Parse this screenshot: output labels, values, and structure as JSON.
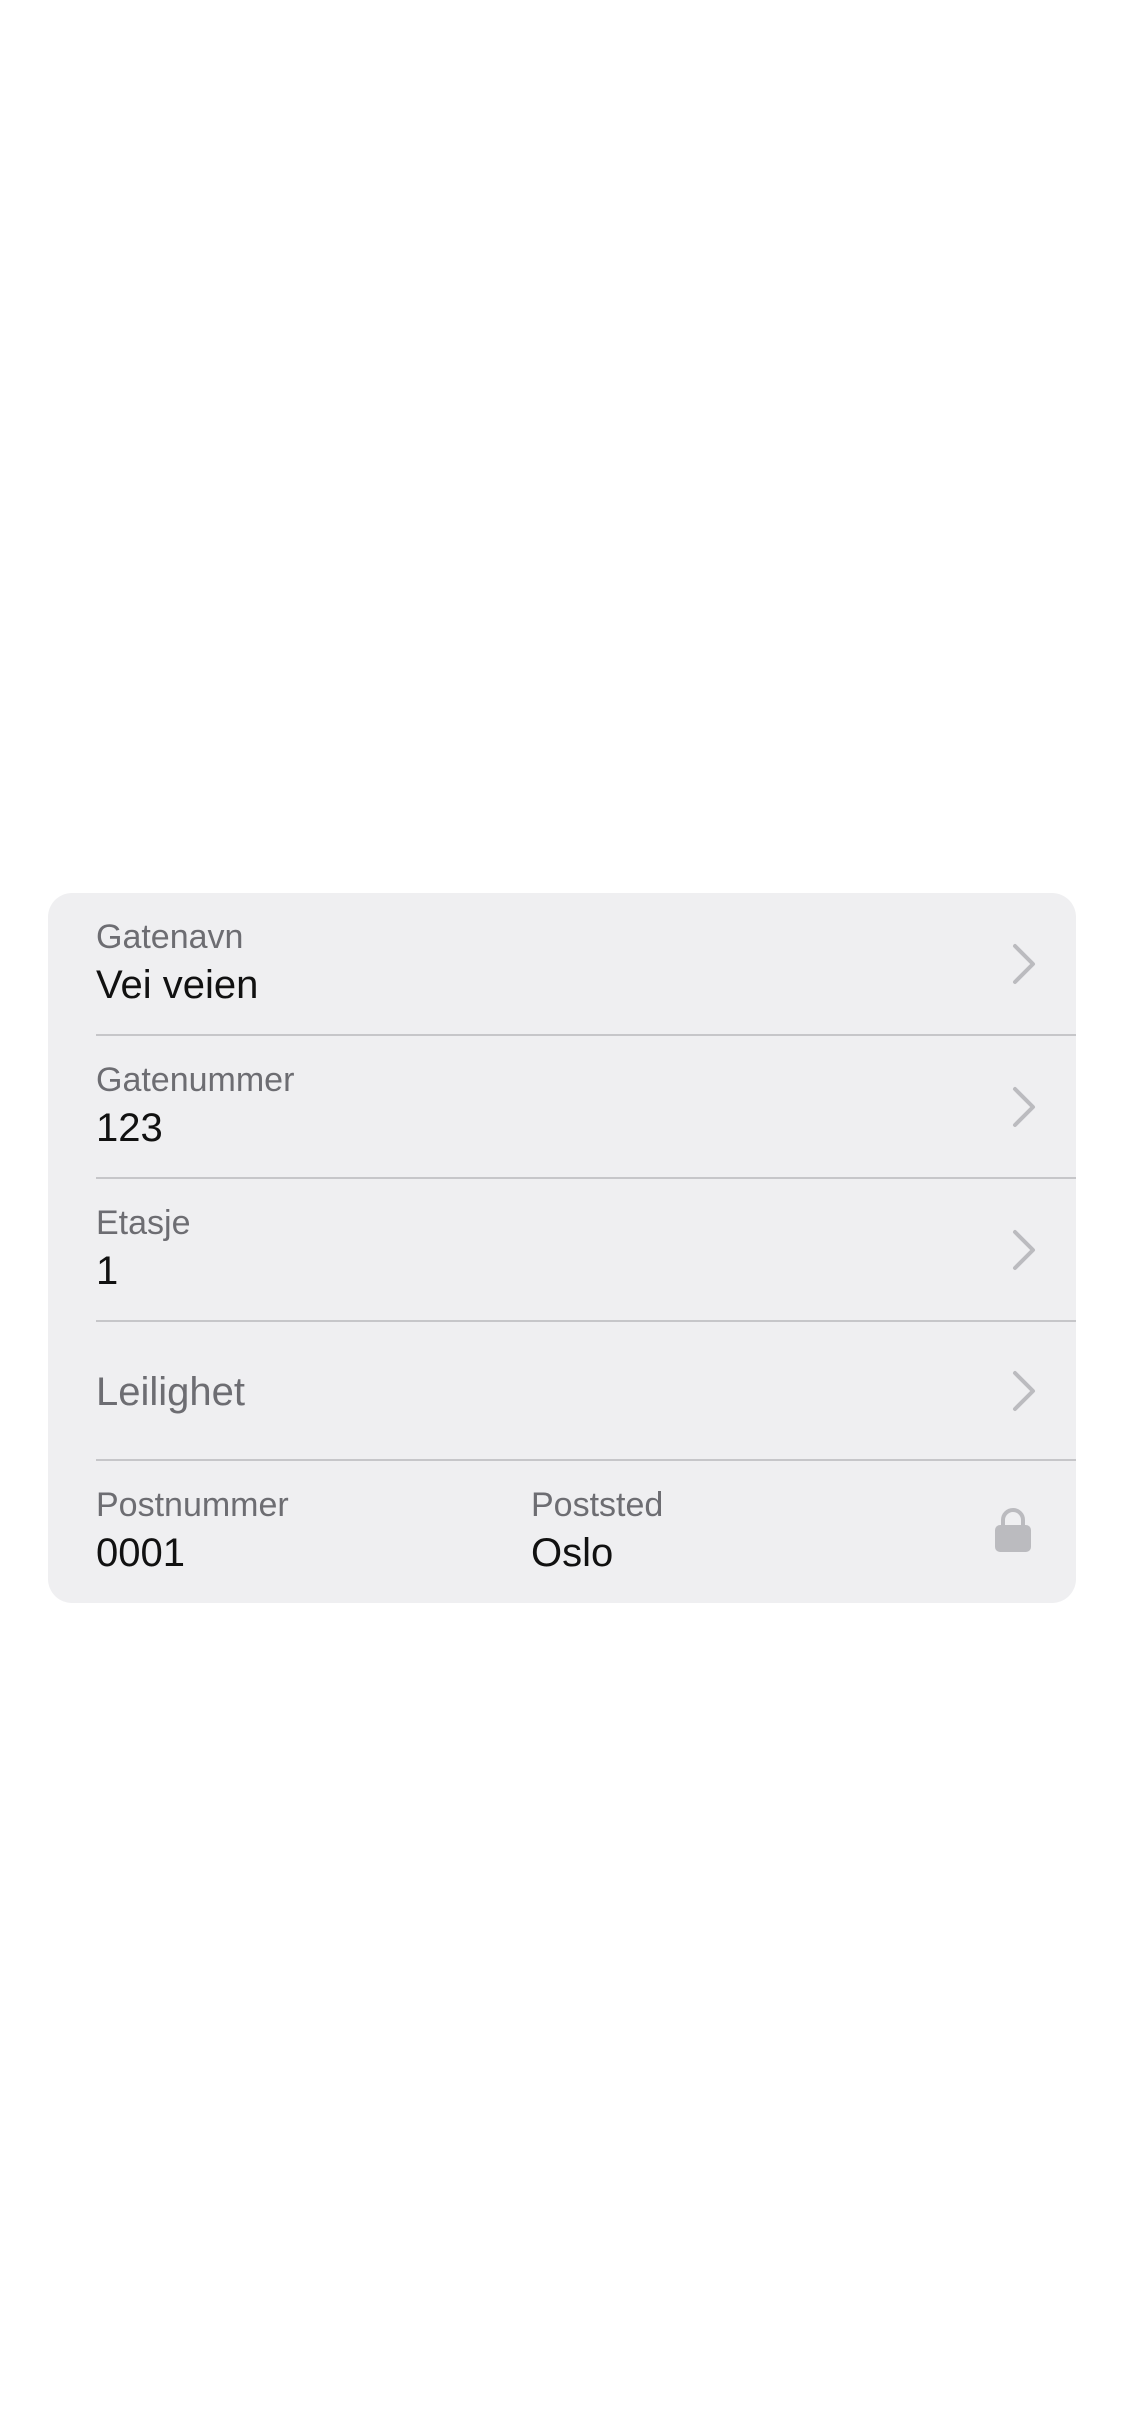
{
  "address_form": {
    "street_name": {
      "label": "Gatenavn",
      "value": "Vei veien"
    },
    "street_number": {
      "label": "Gatenummer",
      "value": "123"
    },
    "floor": {
      "label": "Etasje",
      "value": "1"
    },
    "apartment": {
      "placeholder": "Leilighet"
    },
    "postal_code": {
      "label": "Postnummer",
      "value": "0001"
    },
    "city": {
      "label": "Poststed",
      "value": "Oslo"
    }
  },
  "icons": {
    "chevron": "chevron-right-icon",
    "lock": "lock-icon"
  },
  "colors": {
    "card_background": "#efeff1",
    "label": "#6d6d72",
    "value": "#111111",
    "icon": "#bbbbbf",
    "divider": "#c6c6c9"
  }
}
